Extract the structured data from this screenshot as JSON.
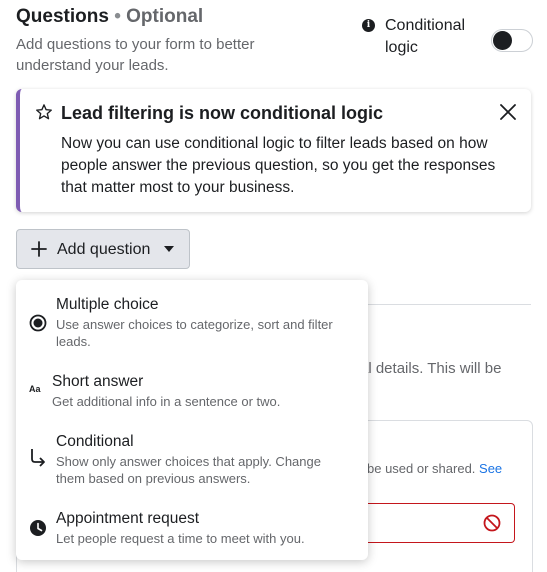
{
  "header": {
    "title": "Questions",
    "separator": "•",
    "optional": "Optional",
    "subtitle": "Add questions to your form to better understand your leads."
  },
  "conditional_logic": {
    "label": "Conditional logic",
    "info_icon": "info-icon",
    "enabled": false
  },
  "banner": {
    "icon": "star-icon",
    "title": "Lead filtering is now conditional logic",
    "body": "Now you can use conditional logic to filter leads based on how people answer the previous question, so you get the responses that matter most to your business.",
    "accent_color": "#7e5cb3"
  },
  "add_question": {
    "label": "Add question"
  },
  "dropdown": {
    "items": [
      {
        "name": "Multiple choice",
        "description": "Use answer choices to categorize, sort and filter leads.",
        "icon": "radio-icon"
      },
      {
        "name": "Short answer",
        "description": "Get additional info in a sentence or two.",
        "icon": "text-aa-icon",
        "icon_glyph": "Aa"
      },
      {
        "name": "Conditional",
        "description": "Show only answer choices that apply. Change them based on previous answers.",
        "icon": "branch-arrow-icon"
      },
      {
        "name": "Appointment request",
        "description": "Let people request a time to meet with you.",
        "icon": "clock-icon"
      }
    ]
  },
  "background": {
    "text1": "al details. This will be",
    "text2": "be used or shared.",
    "text2_link": "See",
    "error_color": "#c4161c"
  }
}
